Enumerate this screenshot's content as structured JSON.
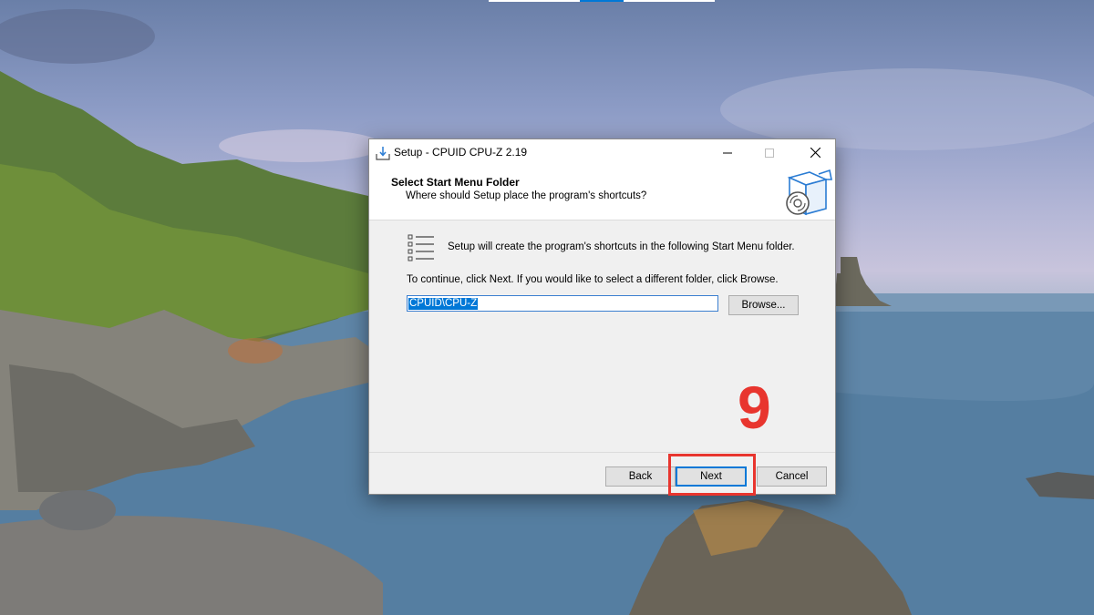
{
  "window": {
    "title": "Setup - CPUID CPU-Z 2.19",
    "controls": {
      "minimize_icon": "minimize-icon",
      "maximize_icon": "maximize-icon",
      "close_icon": "close-icon"
    }
  },
  "header": {
    "title": "Select Start Menu Folder",
    "subtitle": "Where should Setup place the program's shortcuts?",
    "icon": "setup-box-icon"
  },
  "body": {
    "info_icon": "list-icon",
    "info_text": "Setup will create the program's shortcuts in the following Start Menu folder.",
    "continue_text": "To continue, click Next. If you would like to select a different folder, click Browse.",
    "folder_value": "CPUID\\CPU-Z",
    "browse_label": "Browse..."
  },
  "footer": {
    "back_label": "Back",
    "next_label": "Next",
    "cancel_label": "Cancel"
  },
  "annotation": {
    "step_number": "9",
    "color": "#e8352e"
  },
  "colors": {
    "accent": "#0078d7",
    "dialog_bg": "#f0f0f0"
  }
}
